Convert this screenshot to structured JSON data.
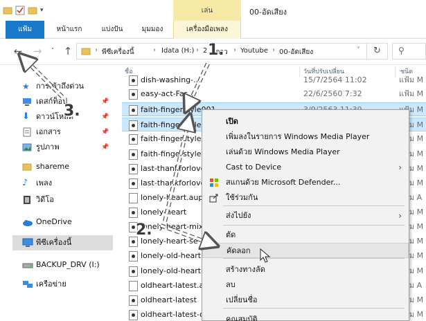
{
  "window": {
    "title": "00-อัดเสียง",
    "context_group": "เล่น"
  },
  "ribbon": {
    "tabs": [
      "แฟ้ม",
      "หน้าแรก",
      "แบ่งปัน",
      "มุมมอง",
      "เครื่องมือเพลง"
    ]
  },
  "address": {
    "crumbs": [
      "พีซีเครื่องนี้",
      "Idata (H:)",
      "2",
      "Youtube",
      "00-อัดเสียง"
    ],
    "crumb_partial": "ดาว"
  },
  "columns": {
    "name": "ชื่อ",
    "date": "วันที่ปรับเปลี่ยน",
    "type": "ชนิด"
  },
  "navpane": {
    "quick_access": "การเข้าถึงด่วน",
    "items": [
      {
        "label": "เดสก์ท็อป",
        "icon": "desktop-icon"
      },
      {
        "label": "ดาวน์โหลด",
        "icon": "download-icon"
      },
      {
        "label": "เอกสาร",
        "icon": "documents-icon"
      },
      {
        "label": "รูปภาพ",
        "icon": "pictures-icon"
      },
      {
        "label": "shareme",
        "icon": "folder-icon"
      },
      {
        "label": "เพลง",
        "icon": "music-icon"
      },
      {
        "label": "วิดีโอ",
        "icon": "video-icon"
      }
    ],
    "onedrive": "OneDrive",
    "this_pc": "พีซีเครื่องนี้",
    "drive": "BACKUP_DRV (I:)",
    "network": "เครือข่าย"
  },
  "files": [
    {
      "name": "dish-washing-...",
      "date": "15/7/2564 11:02",
      "type": "แฟ้ม M",
      "kind": "audio",
      "selected": false
    },
    {
      "name": "easy-act-Far...",
      "date": "22/6/2560 7:32",
      "type": "แฟ้ม M",
      "kind": "audio",
      "selected": false
    },
    {
      "name": "faith-fingerstyle001",
      "date": "3/9/2563 11:39",
      "type": "แฟ้ม M",
      "kind": "audio",
      "selected": true
    },
    {
      "name": "faith-fingerstyle0",
      "date": "",
      "type": "แฟ้ม M",
      "kind": "audio",
      "selected": true
    },
    {
      "name": "faith-fingerstyle0",
      "date": "",
      "type": "แฟ้ม M",
      "kind": "audio",
      "selected": false
    },
    {
      "name": "faith-fingerstyle0",
      "date": "",
      "type": "แฟ้ม M",
      "kind": "audio",
      "selected": false
    },
    {
      "name": "last-thankforlove",
      "date": "",
      "type": "แฟ้ม M",
      "kind": "audio",
      "selected": false
    },
    {
      "name": "last-thankforlove",
      "date": "",
      "type": "แฟ้ม M",
      "kind": "audio",
      "selected": false
    },
    {
      "name": "lonely-heart.aup",
      "date": "",
      "type": "แฟ้ม A",
      "kind": "text",
      "selected": false
    },
    {
      "name": "lonely-heart",
      "date": "",
      "type": "แฟ้ม M",
      "kind": "audio",
      "selected": false
    },
    {
      "name": "lonely-heart-mix",
      "date": "",
      "type": "แฟ้ม M",
      "kind": "audio",
      "selected": false
    },
    {
      "name": "lonely-heart-se",
      "date": "",
      "type": "แฟ้ม M",
      "kind": "audio",
      "selected": false
    },
    {
      "name": "lonely-old-heart",
      "date": "",
      "type": "แฟ้ม M",
      "kind": "audio",
      "selected": false
    },
    {
      "name": "lonely-old-heart-",
      "date": "",
      "type": "แฟ้ม M",
      "kind": "audio",
      "selected": false
    },
    {
      "name": "oldheart-latest.au",
      "date": "",
      "type": "แฟ้ม A",
      "kind": "text",
      "selected": false
    },
    {
      "name": "oldheart-latest",
      "date": "",
      "type": "แฟ้ม M",
      "kind": "audio",
      "selected": false
    },
    {
      "name": "oldheart-latest-o",
      "date": "",
      "type": "แฟ้ม M",
      "kind": "audio",
      "selected": false
    }
  ],
  "context_menu": {
    "items": [
      {
        "label": "เปิด",
        "bold": true
      },
      {
        "label": "เพิ่มลงในรายการ Windows Media Player"
      },
      {
        "label": "เล่นด้วย Windows Media Player"
      },
      {
        "label": "Cast to Device",
        "submenu": true
      },
      {
        "label": "สแกนด้วย Microsoft Defender...",
        "icon": "defender-icon"
      },
      {
        "label": "ใช้ร่วมกัน",
        "icon": "share-icon"
      },
      {
        "label": "ส่งไปยัง",
        "submenu": true
      },
      {
        "label": "ตัด"
      },
      {
        "label": "คัดลอก",
        "hover": true
      },
      {
        "label": "สร้างทางลัด"
      },
      {
        "label": "ลบ"
      },
      {
        "label": "เปลี่ยนชื่อ"
      },
      {
        "label": "คุณสมบัติ"
      }
    ]
  },
  "annotations": {
    "step1": "1.",
    "step2": "2.",
    "step3": "3."
  },
  "colors": {
    "accent": "#1979ca",
    "context_tab": "#f6e9a6",
    "selection": "#cce8ff"
  }
}
